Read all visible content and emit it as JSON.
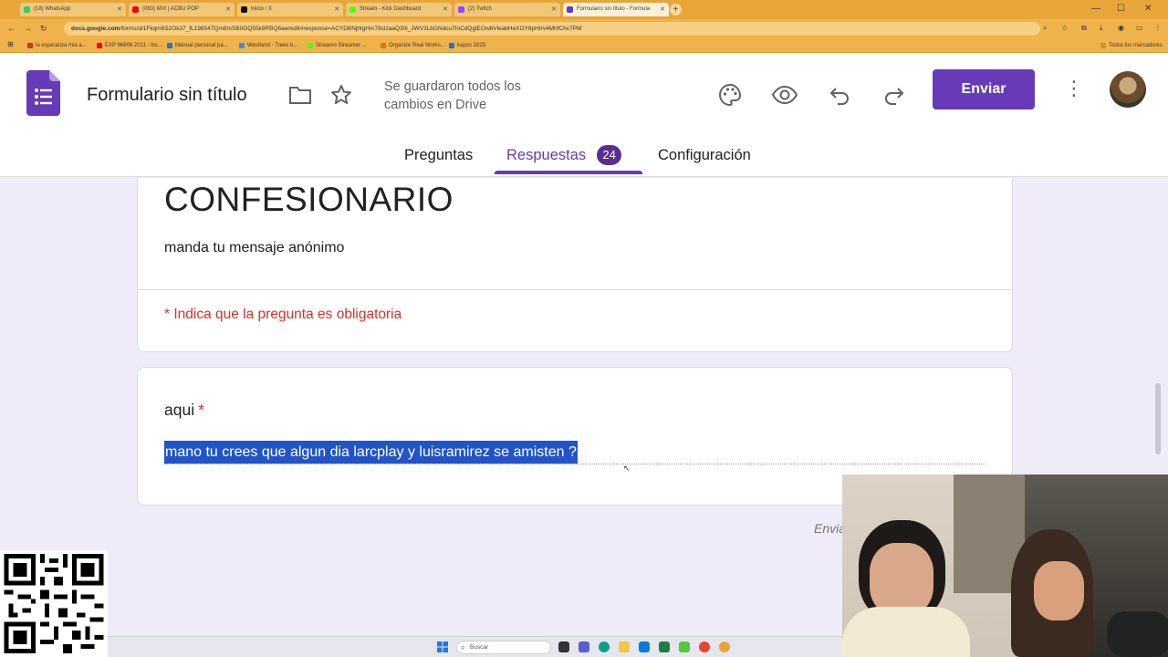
{
  "browser": {
    "tabs": [
      {
        "label": "(18) WhatsApp",
        "color": "#25d366",
        "active": false
      },
      {
        "label": "(083) MIX | ACBU POP",
        "color": "#ff0000",
        "active": false
      },
      {
        "label": "Inicio / X",
        "color": "#111111",
        "active": false
      },
      {
        "label": "Stream - Kick Dashboard",
        "color": "#53fc18",
        "active": false
      },
      {
        "label": "(2) Twitch",
        "color": "#9146ff",
        "active": false
      },
      {
        "label": "Formulario sin título - Formula",
        "color": "#673ab7",
        "active": true
      }
    ],
    "url_host": "docs.google.com",
    "url_path": "/forms/d/1Fkqm6S2Ok37_fL198547Qm8mSB0GQ55k9RBQ6aw/edit#response=ACYDBNjhtgHm78clzaaQ30l_JWV3LbGNdcu7InCdQglEOwbVleabHeXOY8pHIrv4MhfChc7PM",
    "bookmarks": [
      {
        "label": "la esperanza mia a...",
        "color": "#c0392b"
      },
      {
        "label": "EXP 96606 2011 - Inc...",
        "color": "#ff0000"
      },
      {
        "label": "Manual personal pa...",
        "color": "#1a73e8"
      },
      {
        "label": "Westland - Trees b...",
        "color": "#4285f4"
      },
      {
        "label": "Streamo Streamer ...",
        "color": "#53fc18"
      },
      {
        "label": "Organize Real Works...",
        "color": "#e37400"
      },
      {
        "label": "kapos 2025",
        "color": "#1a73e8"
      }
    ],
    "all_bookmarks_label": "Todos los marcadores"
  },
  "header": {
    "title": "Formulario sin título",
    "save_status_line1": "Se guardaron todos los",
    "save_status_line2": "cambios en Drive",
    "send_label": "Enviar",
    "tabs": [
      {
        "label": "Preguntas",
        "active": false
      },
      {
        "label": "Respuestas",
        "active": true,
        "badge": "24"
      },
      {
        "label": "Configuración",
        "active": false
      }
    ]
  },
  "form": {
    "title": "CONFESIONARIO",
    "description": "manda tu mensaje anónimo",
    "required_note": "* Indica que la pregunta es obligatoria",
    "question": {
      "label": "aqui",
      "required_mark": "*",
      "answer": "mano tu crees que algun dia larcplay y luisramirez se amisten ?"
    },
    "submit_note": "Envia"
  },
  "taskbar": {
    "search_placeholder": "Buscar"
  },
  "colors": {
    "accent": "#673ab7",
    "selection": "#2254c8",
    "required": "#d93025",
    "background": "#f0ebf8"
  }
}
